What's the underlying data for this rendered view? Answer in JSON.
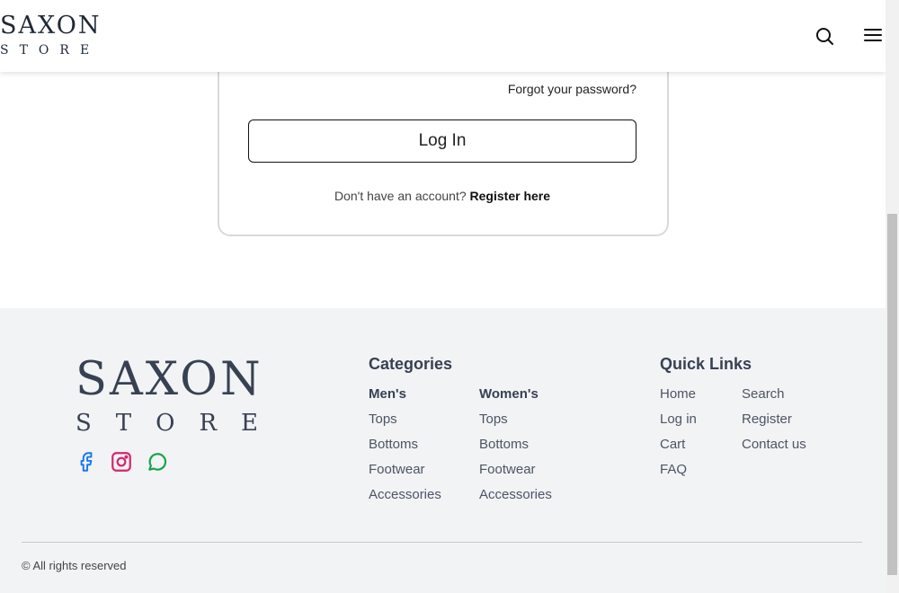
{
  "header": {
    "logo_line1": "SAXON",
    "logo_line2": "STORE",
    "search_icon": "search-icon",
    "menu_icon": "hamburger-menu-icon"
  },
  "login": {
    "forgot_password": "Forgot your password?",
    "login_button": "Log In",
    "no_account_text": "Don't have an account?",
    "register_link": "Register here"
  },
  "footer": {
    "logo_line1": "SAXON",
    "logo_line2": "STORE",
    "social": [
      "facebook-icon",
      "instagram-icon",
      "whatsapp-icon"
    ],
    "categories": {
      "title": "Categories",
      "mens": {
        "heading": "Men's",
        "links": [
          "Tops",
          "Bottoms",
          "Footwear",
          "Accessories"
        ]
      },
      "womens": {
        "heading": "Women's",
        "links": [
          "Tops",
          "Bottoms",
          "Footwear",
          "Accessories"
        ]
      }
    },
    "quick_links": {
      "title": "Quick Links",
      "col1": [
        "Home",
        "Log in",
        "Cart",
        "FAQ"
      ],
      "col2": [
        "Search",
        "Register",
        "Contact us"
      ]
    },
    "copyright": "© All rights reserved"
  },
  "colors": {
    "facebook": "#1877f2",
    "instagram": "#d6246e",
    "whatsapp": "#16a34a",
    "footer_bg": "#f2f3f5"
  }
}
